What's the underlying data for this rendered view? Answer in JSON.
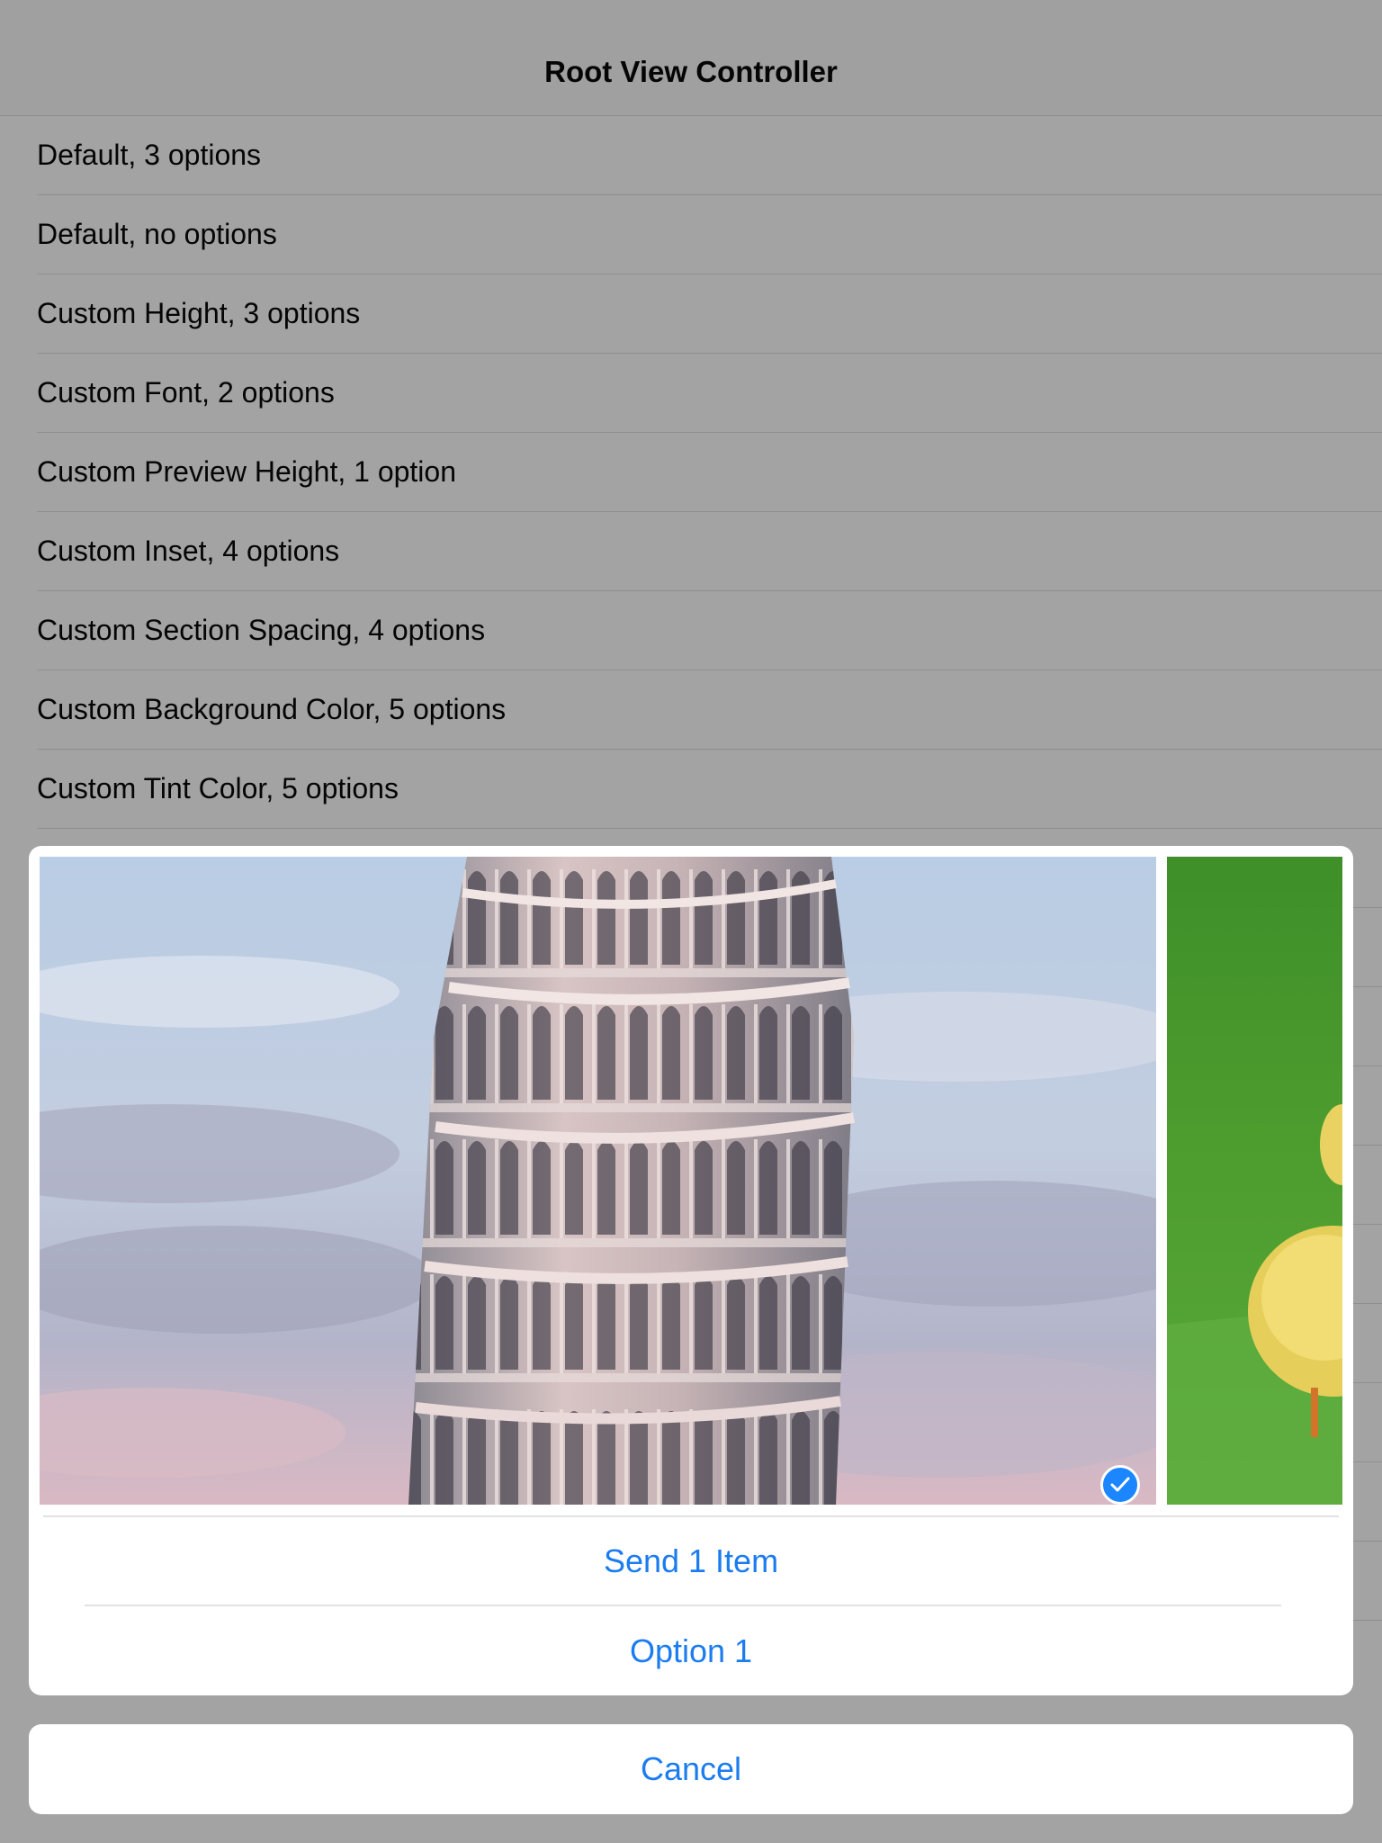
{
  "navbar": {
    "title": "Root View Controller"
  },
  "table": {
    "rows": [
      {
        "label": "Default, 3 options"
      },
      {
        "label": "Default, no options"
      },
      {
        "label": "Custom Height, 3 options"
      },
      {
        "label": "Custom Font, 2 options"
      },
      {
        "label": "Custom Preview Height, 1 option"
      },
      {
        "label": "Custom Inset, 4 options"
      },
      {
        "label": "Custom Section Spacing, 4 options"
      },
      {
        "label": "Custom Background Color, 5 options"
      },
      {
        "label": "Custom Tint Color, 5 options"
      }
    ]
  },
  "sheet": {
    "photos": [
      {
        "subject": "Leaning Tower of Pisa",
        "selected": true
      },
      {
        "subject": "Duckling on grass",
        "selected": false
      }
    ],
    "send_label": "Send 1 Item",
    "option1_label": "Option 1",
    "cancel_label": "Cancel",
    "tint_color": "#1b7cf0",
    "badge_color": "#1b86ff"
  }
}
